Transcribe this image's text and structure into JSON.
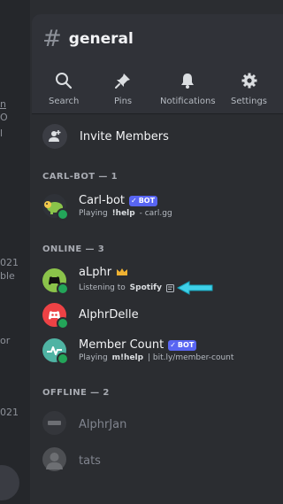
{
  "channel": {
    "prefix": "#",
    "name": "general"
  },
  "toolbar": [
    {
      "label": "Search",
      "icon": "search-icon"
    },
    {
      "label": "Pins",
      "icon": "pin-icon"
    },
    {
      "label": "Notifications",
      "icon": "bell-icon"
    },
    {
      "label": "Settings",
      "icon": "gear-icon"
    }
  ],
  "invite": {
    "label": "Invite Members"
  },
  "sections": {
    "carlbot": "CARL-BOT — 1",
    "online": "ONLINE — 3",
    "offline": "OFFLINE — 2"
  },
  "members": {
    "carlbot": {
      "name": "Carl-bot",
      "badge": "BOT",
      "activity_prefix": "Playing",
      "activity_bold": "!help",
      "activity_suffix": "- carl.gg"
    },
    "alphr": {
      "name": "aLphr",
      "activity_prefix": "Listening to",
      "activity_bold": "Spotify"
    },
    "alphrdelle": {
      "name": "AlphrDelle"
    },
    "membercount": {
      "name": "Member Count",
      "badge": "BOT",
      "activity_prefix": "Playing",
      "activity_bold": "m!help",
      "activity_suffix": "| bit.ly/member-count"
    },
    "alphrjan": {
      "name": "AlphrJan"
    },
    "tats": {
      "name": "tats"
    }
  },
  "left_strip_fragments": [
    "n",
    "O",
    "l",
    "021",
    "ble",
    "or",
    "021"
  ],
  "colors": {
    "background": "#2b2d31",
    "header": "#303238",
    "online": "#23a559",
    "bot_badge": "#5865f2",
    "crown": "#f0b232",
    "arrow": "#3fd0e8"
  }
}
